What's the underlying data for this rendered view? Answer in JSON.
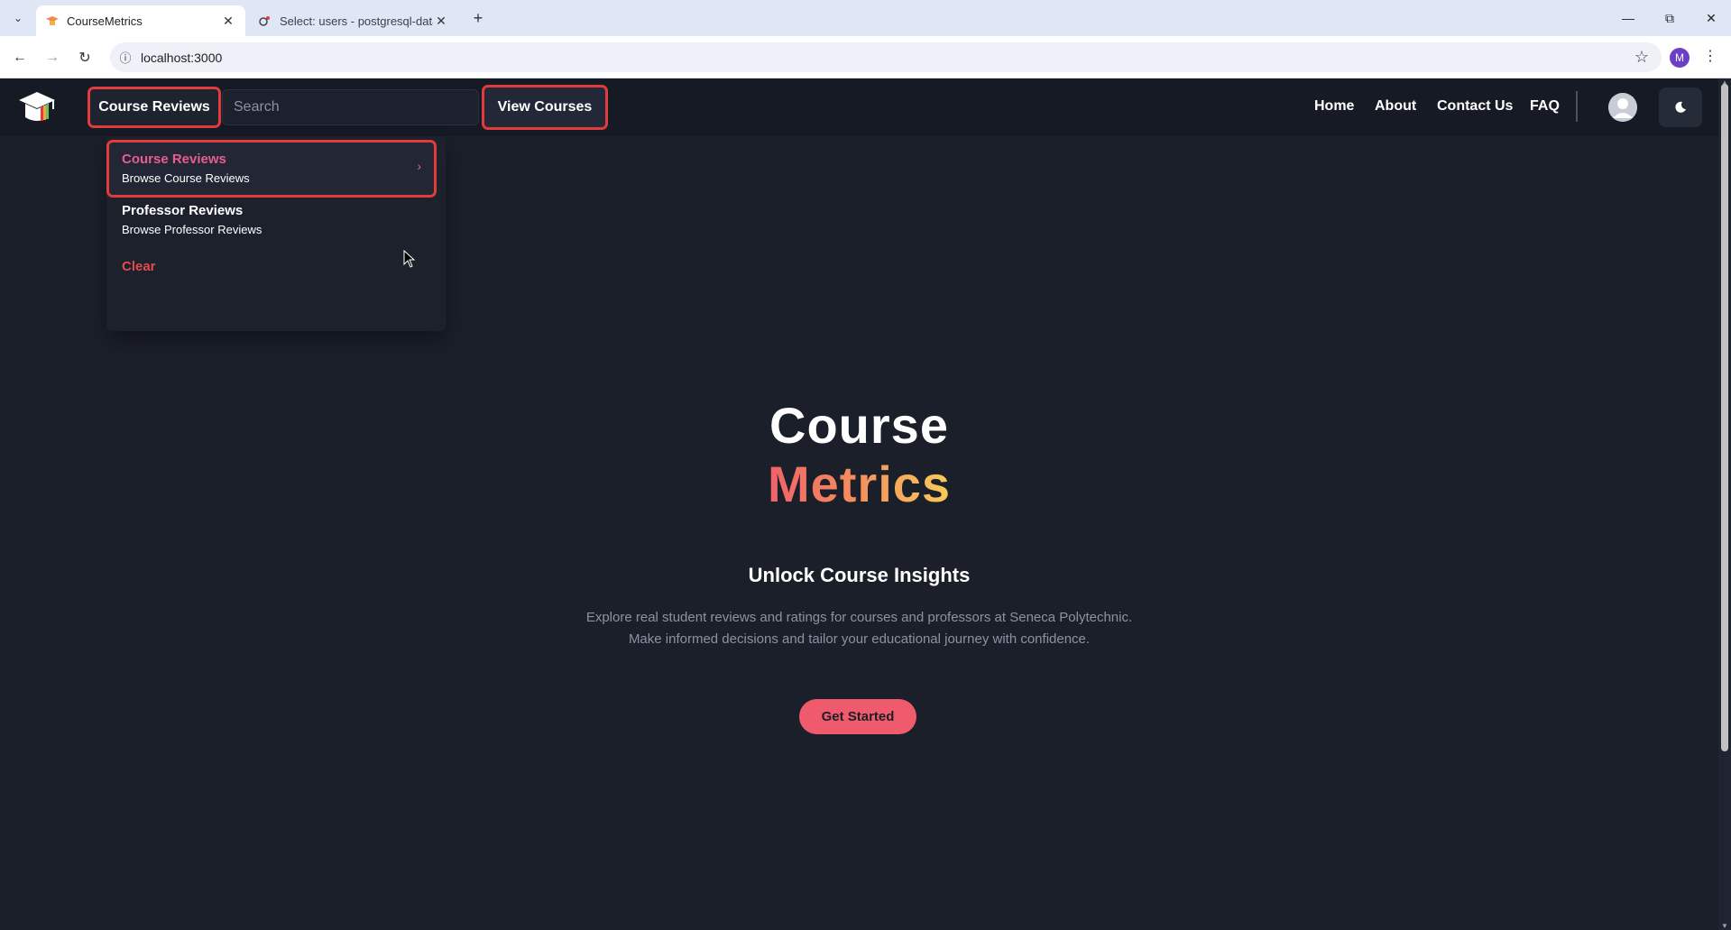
{
  "browser": {
    "tabs": [
      {
        "title": "CourseMetrics",
        "active": true
      },
      {
        "title": "Select: users - postgresql-datab",
        "active": false
      }
    ],
    "url": "localhost:3000",
    "profile_initial": "M"
  },
  "navbar": {
    "dropdown_label": "Course Reviews",
    "search_placeholder": "Search",
    "view_courses_label": "View Courses",
    "links": [
      "Home",
      "About",
      "Contact Us",
      "FAQ"
    ]
  },
  "menu": {
    "items": [
      {
        "title": "Course Reviews",
        "subtitle": "Browse Course Reviews",
        "active": true
      },
      {
        "title": "Professor Reviews",
        "subtitle": "Browse Professor Reviews",
        "active": false
      }
    ],
    "clear_label": "Clear"
  },
  "hero": {
    "title_line1": "Course",
    "title_line2": "Metrics",
    "subtitle": "Unlock Course Insights",
    "description_line1": "Explore real student reviews and ratings for courses and professors at Seneca Polytechnic.",
    "description_line2": "Make informed decisions and tailor your educational journey with confidence.",
    "cta_label": "Get Started"
  },
  "colors": {
    "page_bg": "#1b1f2a",
    "navbar_bg": "#161a24",
    "accent_pink": "#e85d8e",
    "cta": "#ef5a6c",
    "highlight_outline": "#e23b3b",
    "gradient_start": "#f0616a",
    "gradient_end": "#f7cb5a"
  }
}
